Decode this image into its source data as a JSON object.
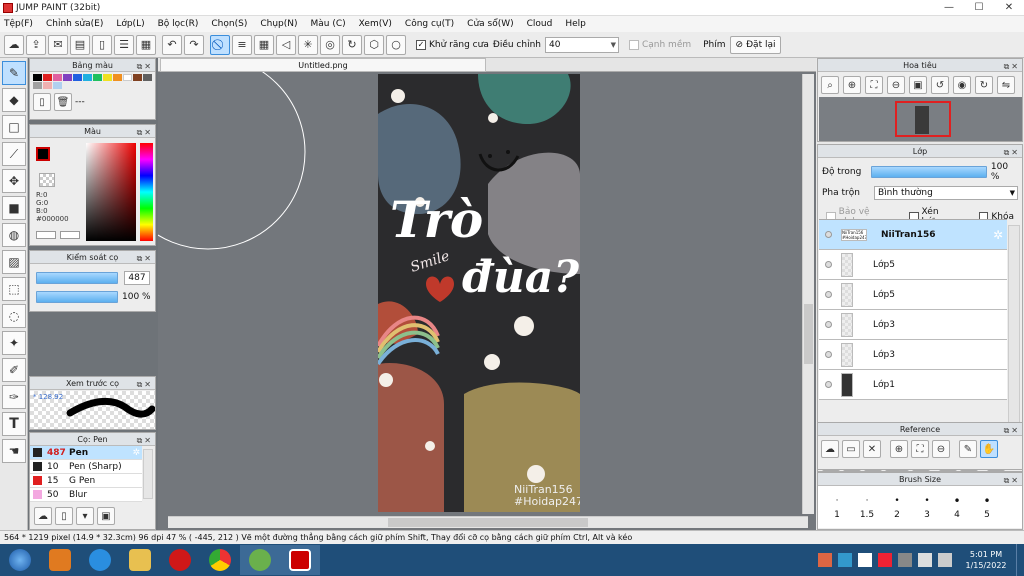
{
  "window": {
    "title": "JUMP PAINT (32bit)",
    "minimize": "—",
    "maximize": "☐",
    "close": "✕"
  },
  "menu": [
    "Tệp(F)",
    "Chỉnh sửa(E)",
    "Lớp(L)",
    "Bộ lọc(R)",
    "Chọn(S)",
    "Chụp(N)",
    "Màu (C)",
    "Xem(V)",
    "Công cụ(T)",
    "Cửa sổ(W)",
    "Cloud",
    "Help"
  ],
  "toolbar": {
    "antialias_label": "Khử răng cưa",
    "adjust_label": "Điều chỉnh",
    "adjust_value": "40",
    "soft_edge_label": "Cạnh mềm",
    "key_label": "Phím",
    "reset_label": "Đặt lại"
  },
  "palette_panel": {
    "title": "Bảng màu",
    "value": "---"
  },
  "color_panel": {
    "title": "Màu",
    "r": "R:0",
    "g": "G:0",
    "b": "B:0",
    "hex": "#000000"
  },
  "brush_control": {
    "title": "Kiểm soát cọ",
    "size": "487",
    "opacity": "100 %"
  },
  "preview_panel": {
    "title": "Xem trước cọ",
    "value": "* 128.92"
  },
  "brush_panel": {
    "title": "Cọ: Pen",
    "items": [
      {
        "size": "487",
        "name": "Pen",
        "color": "#222222"
      },
      {
        "size": "10",
        "name": "Pen (Sharp)",
        "color": "#222222"
      },
      {
        "size": "15",
        "name": "G Pen",
        "color": "#e02020"
      },
      {
        "size": "50",
        "name": "Blur",
        "color": "#f3a8e0"
      }
    ]
  },
  "document": {
    "tab": "Untitled.png"
  },
  "artwork": {
    "title_line1": "Trò",
    "title_line2": "đùa?",
    "script": "Smile",
    "credit1": "NiiTran156",
    "credit2": "#Hoidap247"
  },
  "navigator": {
    "title": "Hoa tiêu"
  },
  "layer_panel": {
    "title": "Lớp",
    "opacity_label": "Độ trong",
    "opacity_value": "100 %",
    "blend_label": "Pha trộn",
    "blend_value": "Bình thường",
    "protect_alpha": "Bảo vệ alpha",
    "clip": "Xén bớt",
    "lock": "Khóa",
    "layers": [
      {
        "name": "NiiTran156",
        "thumb_text": "NiiTran156 #Hoidap247"
      },
      {
        "name": "Lớp5"
      },
      {
        "name": "Lớp5"
      },
      {
        "name": "Lớp3"
      },
      {
        "name": "Lớp3"
      },
      {
        "name": "Lớp1"
      }
    ]
  },
  "reference_panel": {
    "title": "Reference"
  },
  "brush_size_panel": {
    "title": "Brush Size",
    "sizes": [
      "1",
      "1.5",
      "2",
      "3",
      "4",
      "5"
    ]
  },
  "status": {
    "text": "564 * 1219 pixel  (14.9 * 32.3cm)  96 dpi  47 %  ( -445, 212 )  Vẽ một đường thẳng bằng cách giữ phím Shift, Thay đổi cỡ cọ bằng cách giữ phím Ctrl, Alt và kéo"
  },
  "taskbar": {
    "time": "5:01 PM",
    "date": "1/15/2022"
  }
}
